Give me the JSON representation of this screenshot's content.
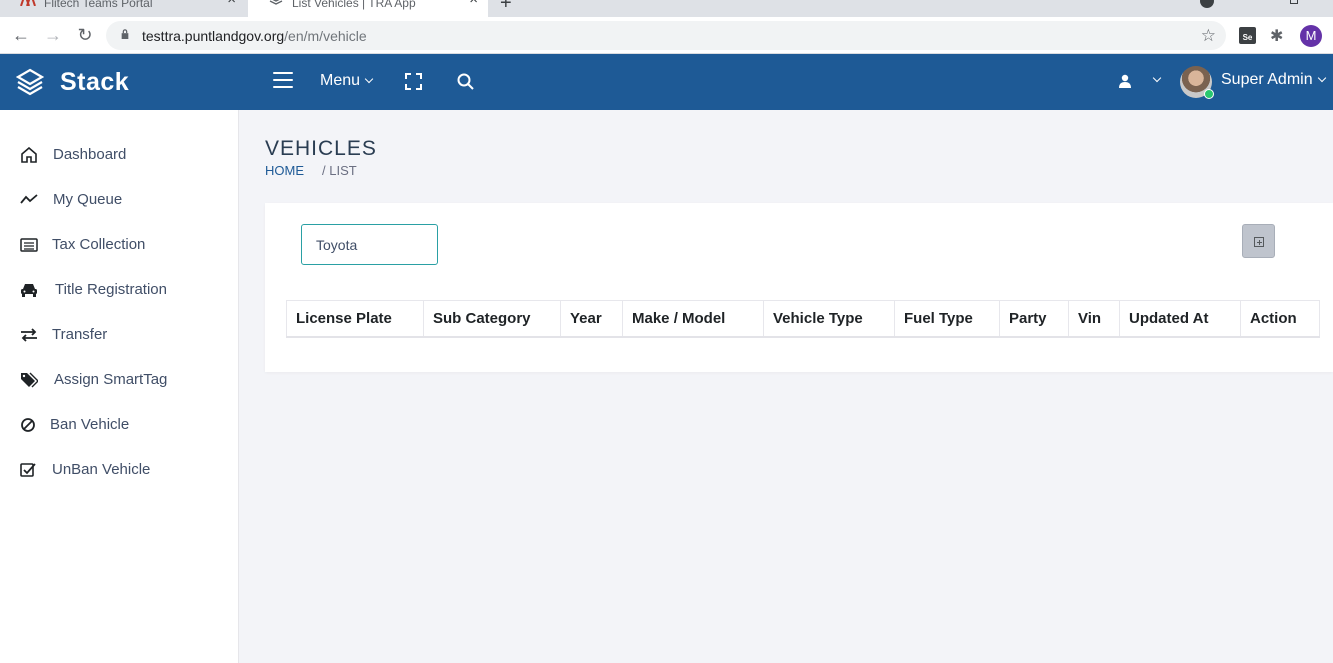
{
  "browser": {
    "tabs": [
      {
        "title": "Flitech Teams Portal"
      },
      {
        "title": "List Vehicles | TRA App"
      }
    ],
    "url_domain": "testtra.puntlandgov.org",
    "url_path": "/en/m/vehicle",
    "profile_initial": "M",
    "extension_label": "Se"
  },
  "header": {
    "brand": "Stack",
    "menu_label": "Menu",
    "user_name": "Super Admin"
  },
  "sidebar": {
    "items": [
      {
        "label": "Dashboard",
        "icon": "home-icon"
      },
      {
        "label": "My Queue",
        "icon": "trend-line-icon"
      },
      {
        "label": "Tax Collection",
        "icon": "list-icon"
      },
      {
        "label": "Title Registration",
        "icon": "car-icon"
      },
      {
        "label": "Transfer",
        "icon": "swap-arrows-icon"
      },
      {
        "label": "Assign SmartTag",
        "icon": "tags-icon"
      },
      {
        "label": "Ban Vehicle",
        "icon": "ban-icon"
      },
      {
        "label": "UnBan Vehicle",
        "icon": "check-square-icon"
      }
    ]
  },
  "page": {
    "title": "VEHICLES",
    "breadcrumb_home": "HOME",
    "breadcrumb_current": "/ LIST"
  },
  "search": {
    "value": "Toyota"
  },
  "table": {
    "columns": [
      "License Plate",
      "Sub Category",
      "Year",
      "Make / Model",
      "Vehicle Type",
      "Fuel Type",
      "Party",
      "Vin",
      "Updated At",
      "Action"
    ]
  },
  "colors": {
    "header_bg": "#1e5a96",
    "search_border": "#2aa0a4",
    "online_status": "#28c76f"
  }
}
